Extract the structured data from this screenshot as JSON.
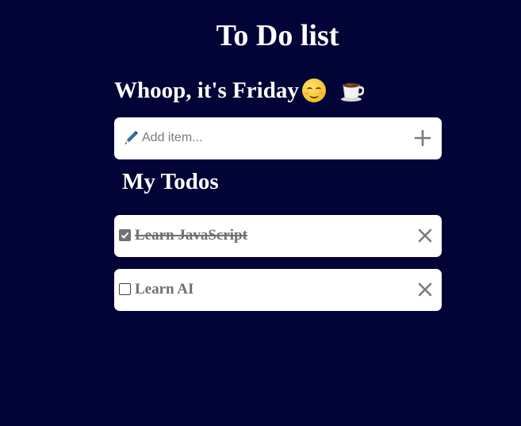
{
  "app": {
    "title": "To Do list",
    "greeting": "Whoop, it's Friday",
    "greeting_emojis": [
      "smiling-face-icon",
      "coffee-cup-icon"
    ]
  },
  "add_item": {
    "placeholder": "Add item...",
    "value": "",
    "icon": "pen-icon",
    "add_icon": "plus-icon"
  },
  "todos_section": {
    "heading": "My Todos",
    "items": [
      {
        "label": "Learn JavaScript",
        "completed": true
      },
      {
        "label": "Learn AI",
        "completed": false
      }
    ]
  },
  "colors": {
    "background": "#020438",
    "card": "#ffffff",
    "muted_text": "#6f6f6f",
    "accent_pen": "#2a6fb0"
  }
}
